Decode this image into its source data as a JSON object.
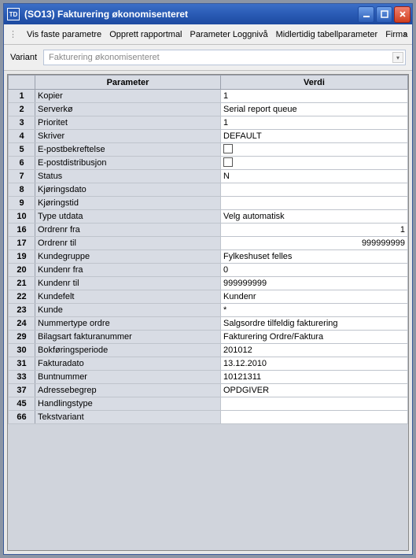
{
  "window": {
    "app_icon_text": "TD",
    "title": "(SO13) Fakturering økonomisenteret"
  },
  "menu": {
    "items": [
      "Vis faste parametre",
      "Opprett rapportmal",
      "Parameter Loggnivå",
      "Midlertidig tabellparameter",
      "Firma"
    ]
  },
  "variant": {
    "label": "Variant",
    "value": "Fakturering økonomisenteret"
  },
  "grid": {
    "headers": {
      "id": "",
      "param": "Parameter",
      "value": "Verdi"
    },
    "rows": [
      {
        "id": "1",
        "param": "Kopier",
        "value": "1",
        "type": "text"
      },
      {
        "id": "2",
        "param": "Serverkø",
        "value": "Serial report queue",
        "type": "text"
      },
      {
        "id": "3",
        "param": "Prioritet",
        "value": "1",
        "type": "text"
      },
      {
        "id": "4",
        "param": "Skriver",
        "value": "DEFAULT",
        "type": "text"
      },
      {
        "id": "5",
        "param": "E-postbekreftelse",
        "value": "",
        "type": "checkbox"
      },
      {
        "id": "6",
        "param": "E-postdistribusjon",
        "value": "",
        "type": "checkbox"
      },
      {
        "id": "7",
        "param": "Status",
        "value": "N",
        "type": "text"
      },
      {
        "id": "8",
        "param": "Kjøringsdato",
        "value": "",
        "type": "text"
      },
      {
        "id": "9",
        "param": "Kjøringstid",
        "value": "",
        "type": "text"
      },
      {
        "id": "10",
        "param": "Type utdata",
        "value": "Velg automatisk",
        "type": "text"
      },
      {
        "id": "16",
        "param": "Ordrenr fra",
        "value": "1",
        "type": "text",
        "align": "right"
      },
      {
        "id": "17",
        "param": "Ordrenr til",
        "value": "999999999",
        "type": "text",
        "align": "right"
      },
      {
        "id": "19",
        "param": "Kundegruppe",
        "value": "Fylkeshuset felles",
        "type": "text"
      },
      {
        "id": "20",
        "param": "Kundenr fra",
        "value": "0",
        "type": "text"
      },
      {
        "id": "21",
        "param": "Kundenr til",
        "value": "999999999",
        "type": "text"
      },
      {
        "id": "22",
        "param": "Kundefelt",
        "value": "Kundenr",
        "type": "text"
      },
      {
        "id": "23",
        "param": "Kunde",
        "value": "*",
        "type": "text"
      },
      {
        "id": "24",
        "param": "Nummertype ordre",
        "value": "Salgsordre tilfeldig fakturering",
        "type": "text"
      },
      {
        "id": "29",
        "param": "Bilagsart fakturanummer",
        "value": "Fakturering Ordre/Faktura",
        "type": "text"
      },
      {
        "id": "30",
        "param": "Bokføringsperiode",
        "value": "201012",
        "type": "text"
      },
      {
        "id": "31",
        "param": "Fakturadato",
        "value": "13.12.2010",
        "type": "text"
      },
      {
        "id": "33",
        "param": "Buntnummer",
        "value": "10121311",
        "type": "text"
      },
      {
        "id": "37",
        "param": "Adressebegrep",
        "value": "OPDGIVER",
        "type": "text"
      },
      {
        "id": "45",
        "param": "Handlingstype",
        "value": "",
        "type": "text"
      },
      {
        "id": "66",
        "param": "Tekstvariant",
        "value": "",
        "type": "text"
      }
    ]
  }
}
